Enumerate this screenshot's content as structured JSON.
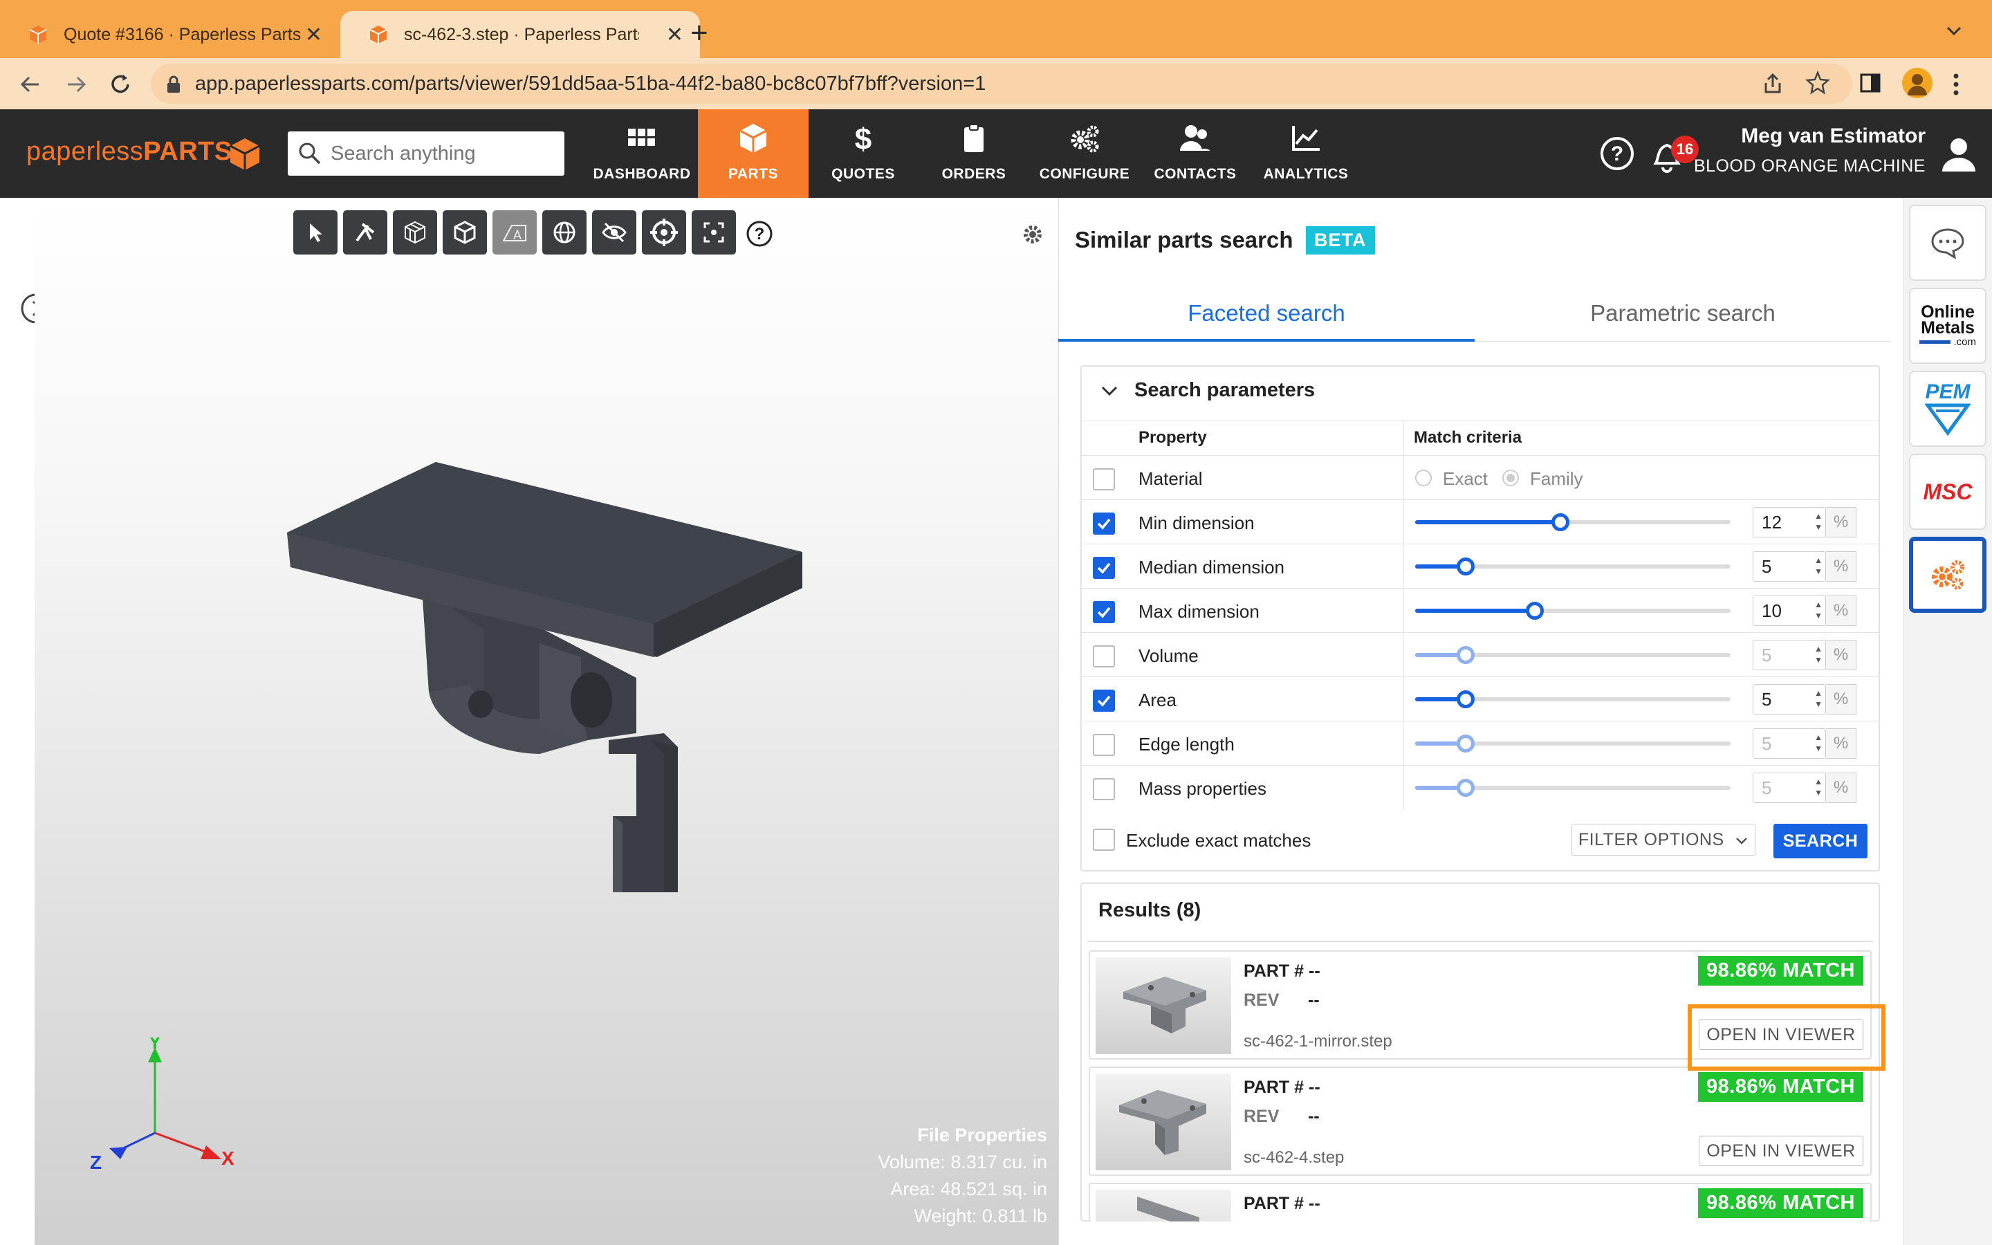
{
  "browser": {
    "tabs": [
      {
        "title": "Quote #3166 · Paperless Parts"
      },
      {
        "title": "sc-462-3.step · Paperless Parts"
      }
    ],
    "url": "app.paperlessparts.com/parts/viewer/591dd5aa-51ba-44f2-ba80-bc8c07bf7bff?version=1"
  },
  "header": {
    "logo_light": "paperless",
    "logo_bold": "PARTS",
    "search_placeholder": "Search anything",
    "nav": [
      {
        "label": "DASHBOARD",
        "icon": "grid-icon"
      },
      {
        "label": "PARTS",
        "icon": "cube-icon",
        "active": true
      },
      {
        "label": "QUOTES",
        "icon": "dollar-icon"
      },
      {
        "label": "ORDERS",
        "icon": "clipboard-icon"
      },
      {
        "label": "CONFIGURE",
        "icon": "gears-icon"
      },
      {
        "label": "CONTACTS",
        "icon": "people-icon"
      },
      {
        "label": "ANALYTICS",
        "icon": "chart-icon"
      }
    ],
    "notification_count": "16",
    "user_name": "Meg van Estimator",
    "company": "BLOOD ORANGE MACHINE"
  },
  "viewer": {
    "file_properties": {
      "title": "File Properties",
      "volume": "Volume: 8.317 cu. in",
      "area": "Area: 48.521 sq. in",
      "weight": "Weight: 0.811 lb"
    },
    "axes": {
      "x": "X",
      "y": "Y",
      "z": "Z"
    }
  },
  "panel": {
    "title": "Similar parts search",
    "badge": "BETA",
    "tabs": [
      "Faceted search",
      "Parametric search"
    ],
    "params_title": "Search parameters",
    "col_property": "Property",
    "col_match": "Match criteria",
    "material": {
      "label": "Material",
      "exact": "Exact",
      "family": "Family"
    },
    "rows": [
      {
        "label": "Min dimension",
        "checked": true,
        "value": "12",
        "slider": 0.46
      },
      {
        "label": "Median dimension",
        "checked": true,
        "value": "5",
        "slider": 0.16
      },
      {
        "label": "Max dimension",
        "checked": true,
        "value": "10",
        "slider": 0.38
      },
      {
        "label": "Volume",
        "checked": false,
        "value": "5",
        "slider": 0.16
      },
      {
        "label": "Area",
        "checked": true,
        "value": "5",
        "slider": 0.16
      },
      {
        "label": "Edge length",
        "checked": false,
        "value": "5",
        "slider": 0.16
      },
      {
        "label": "Mass properties",
        "checked": false,
        "value": "5",
        "slider": 0.16
      }
    ],
    "pct": "%",
    "exclude_label": "Exclude exact matches",
    "filter_btn": "FILTER OPTIONS",
    "search_btn": "SEARCH",
    "results_title": "Results (8)",
    "results": [
      {
        "part_label": "PART #",
        "part": "--",
        "rev_label": "REV",
        "rev": "--",
        "file": "sc-462-1-mirror.step",
        "match": "98.86% MATCH",
        "open": "OPEN IN VIEWER"
      },
      {
        "part_label": "PART #",
        "part": "--",
        "rev_label": "REV",
        "rev": "--",
        "file": "sc-462-4.step",
        "match": "98.86% MATCH",
        "open": "OPEN IN VIEWER"
      },
      {
        "part_label": "PART #",
        "part": "--",
        "match": "98.86% MATCH"
      }
    ]
  },
  "rail": {
    "online_metals": [
      "Online",
      "Metals",
      ".com"
    ],
    "pem": "PEM",
    "msc": "MSC"
  },
  "colors": {
    "accent": "#f47c2a",
    "primary": "#1662e0",
    "match": "#1fc42e",
    "beta": "#19c2d9"
  }
}
